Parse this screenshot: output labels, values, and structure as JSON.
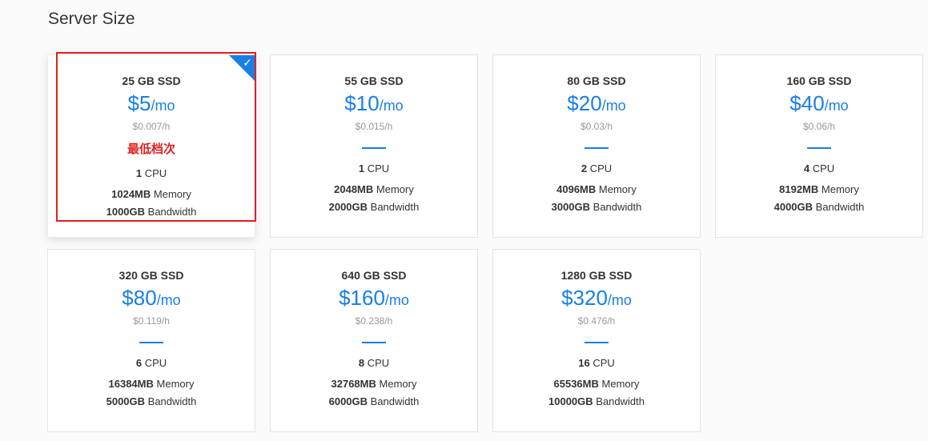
{
  "page": {
    "title": "Server Size"
  },
  "annotation": {
    "text": "最低档次",
    "color": "#e02020"
  },
  "accent_color": "#1a7fe4",
  "plans": [
    {
      "ssd": "25 GB SSD",
      "price": "$5",
      "period": "/mo",
      "hourly": "$0.007/h",
      "cpu": "1",
      "cpu_label": "CPU",
      "memory": "1024MB",
      "memory_label": "Memory",
      "bandwidth": "1000GB",
      "bandwidth_label": "Bandwidth",
      "selected": true
    },
    {
      "ssd": "55 GB SSD",
      "price": "$10",
      "period": "/mo",
      "hourly": "$0.015/h",
      "cpu": "1",
      "cpu_label": "CPU",
      "memory": "2048MB",
      "memory_label": "Memory",
      "bandwidth": "2000GB",
      "bandwidth_label": "Bandwidth",
      "selected": false
    },
    {
      "ssd": "80 GB SSD",
      "price": "$20",
      "period": "/mo",
      "hourly": "$0.03/h",
      "cpu": "2",
      "cpu_label": "CPU",
      "memory": "4096MB",
      "memory_label": "Memory",
      "bandwidth": "3000GB",
      "bandwidth_label": "Bandwidth",
      "selected": false
    },
    {
      "ssd": "160 GB SSD",
      "price": "$40",
      "period": "/mo",
      "hourly": "$0.06/h",
      "cpu": "4",
      "cpu_label": "CPU",
      "memory": "8192MB",
      "memory_label": "Memory",
      "bandwidth": "4000GB",
      "bandwidth_label": "Bandwidth",
      "selected": false
    },
    {
      "ssd": "320 GB SSD",
      "price": "$80",
      "period": "/mo",
      "hourly": "$0.119/h",
      "cpu": "6",
      "cpu_label": "CPU",
      "memory": "16384MB",
      "memory_label": "Memory",
      "bandwidth": "5000GB",
      "bandwidth_label": "Bandwidth",
      "selected": false
    },
    {
      "ssd": "640 GB SSD",
      "price": "$160",
      "period": "/mo",
      "hourly": "$0.238/h",
      "cpu": "8",
      "cpu_label": "CPU",
      "memory": "32768MB",
      "memory_label": "Memory",
      "bandwidth": "6000GB",
      "bandwidth_label": "Bandwidth",
      "selected": false
    },
    {
      "ssd": "1280 GB SSD",
      "price": "$320",
      "period": "/mo",
      "hourly": "$0.476/h",
      "cpu": "16",
      "cpu_label": "CPU",
      "memory": "65536MB",
      "memory_label": "Memory",
      "bandwidth": "10000GB",
      "bandwidth_label": "Bandwidth",
      "selected": false
    }
  ]
}
